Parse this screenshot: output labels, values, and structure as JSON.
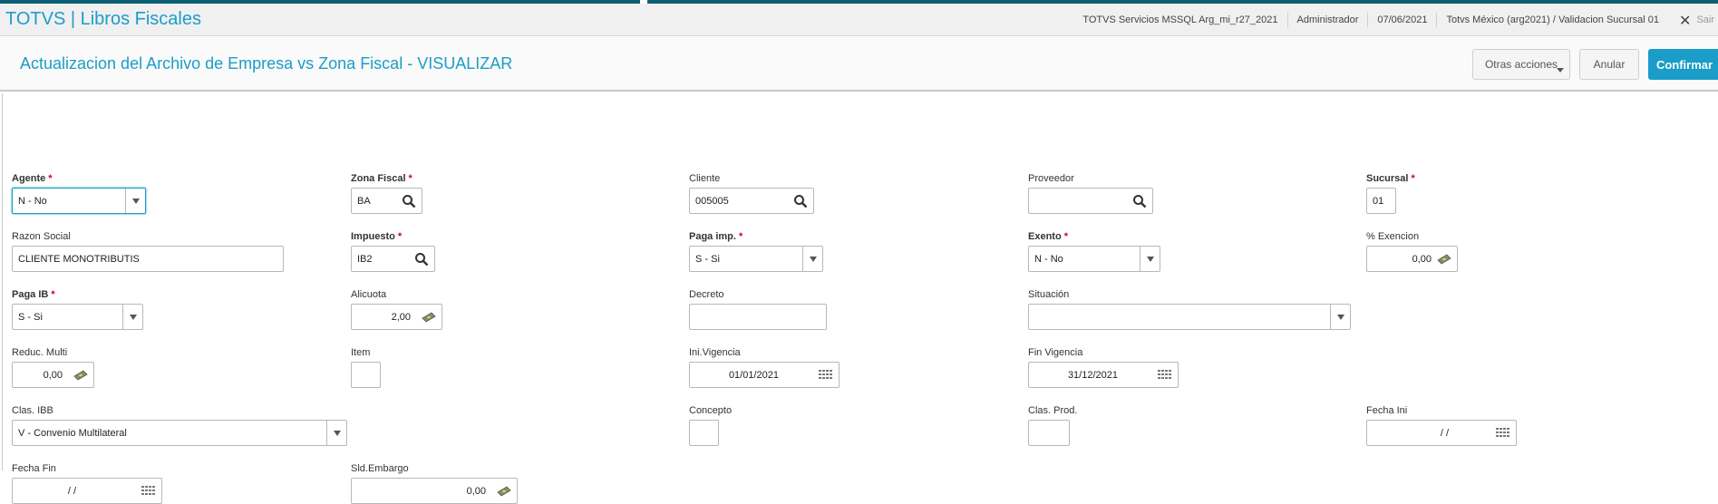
{
  "app": {
    "title": "TOTVS | Libros Fiscales"
  },
  "header": {
    "environment": "TOTVS Servicios MSSQL Arg_mi_r27_2021",
    "user": "Administrador",
    "date": "07/06/2021",
    "company": "Totvs México (arg2021) / Validacion Sucursal 01",
    "exit_label": "Sair"
  },
  "page": {
    "title": "Actualizacion del Archivo de Empresa vs Zona Fiscal - VISUALIZAR",
    "actions": {
      "otras": "Otras acciones",
      "anular": "Anular",
      "confirmar": "Confirmar"
    }
  },
  "colors": {
    "accent": "#1a9dc9",
    "required": "#d0021b",
    "topstrip": "#0b5f74"
  },
  "fields": {
    "agente": {
      "label": "Agente",
      "value": "N - No",
      "required": true
    },
    "zona_fiscal": {
      "label": "Zona Fiscal",
      "value": "BA",
      "required": true
    },
    "cliente": {
      "label": "Cliente",
      "value": "005005"
    },
    "proveedor": {
      "label": "Proveedor",
      "value": ""
    },
    "sucursal": {
      "label": "Sucursal",
      "value": "01",
      "required": true
    },
    "razon_social": {
      "label": "Razon Social",
      "value": "CLIENTE MONOTRIBUTIS"
    },
    "impuesto": {
      "label": "Impuesto",
      "value": "IB2",
      "required": true
    },
    "paga_imp": {
      "label": "Paga imp.",
      "value": "S - Si",
      "required": true
    },
    "exento": {
      "label": "Exento",
      "value": "N - No",
      "required": true
    },
    "pct_exencion": {
      "label": "% Exencion",
      "value": "0,00"
    },
    "paga_ib": {
      "label": "Paga IB",
      "value": "S - Si",
      "required": true
    },
    "alicuota": {
      "label": "Alicuota",
      "value": "2,00"
    },
    "decreto": {
      "label": "Decreto",
      "value": ""
    },
    "situacion": {
      "label": "Situación",
      "value": ""
    },
    "reduc_multi": {
      "label": "Reduc. Multi",
      "value": "0,00"
    },
    "item": {
      "label": "Item",
      "value": ""
    },
    "ini_vigencia": {
      "label": "Ini.Vigencia",
      "value": "01/01/2021"
    },
    "fin_vigencia": {
      "label": "Fin Vigencia",
      "value": "31/12/2021"
    },
    "clas_ibb": {
      "label": "Clas. IBB",
      "value": "V - Convenio Multilateral"
    },
    "concepto": {
      "label": "Concepto",
      "value": ""
    },
    "clas_prod": {
      "label": "Clas. Prod.",
      "value": ""
    },
    "fecha_ini": {
      "label": "Fecha Ini",
      "value": "/ /"
    },
    "fecha_fin": {
      "label": "Fecha Fin",
      "value": "/ /"
    },
    "sld_embargo": {
      "label": "Sld.Embargo",
      "value": "0,00"
    }
  },
  "icons": {
    "search": "magnifier-icon",
    "money": "money-icon",
    "calendar": "calendar-icon",
    "dropdown": "chevron-down-icon",
    "close": "close-icon"
  }
}
